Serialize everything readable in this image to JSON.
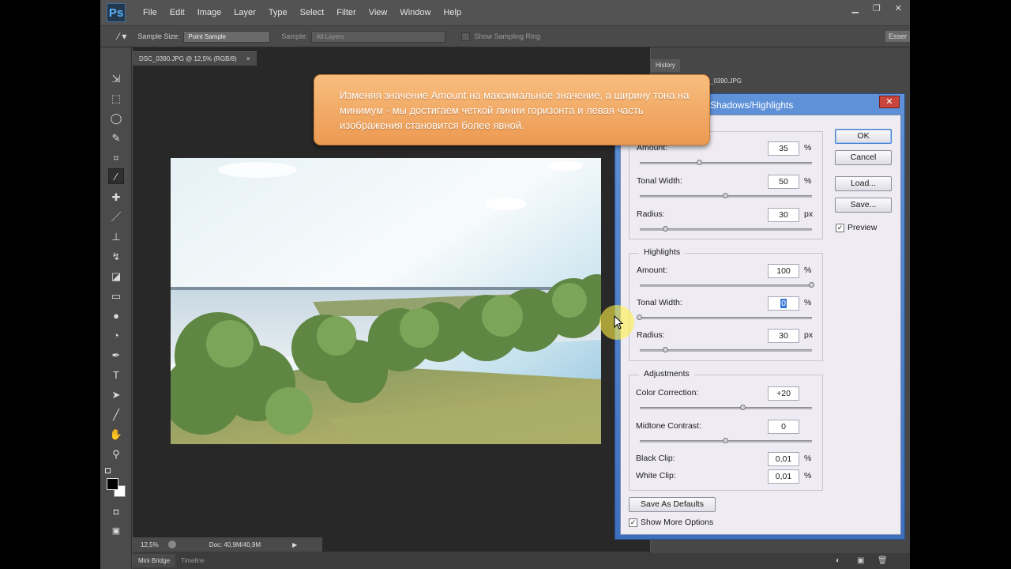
{
  "menubar": {
    "logo": "Ps",
    "items": [
      "File",
      "Edit",
      "Image",
      "Layer",
      "Type",
      "Select",
      "Filter",
      "View",
      "Window",
      "Help"
    ]
  },
  "optionsbar": {
    "sample_size_label": "Sample Size:",
    "sample_size_value": "Point Sample",
    "sample_label": "Sample:",
    "sample_value": "All Layers",
    "sampling_ring_label": "Show Sampling Ring",
    "essentials": "Esser"
  },
  "document": {
    "tab_title": "DSC_0390.JPG @ 12,5% (RGB/8)",
    "zoom": "12,5%",
    "doc_size": "Doc: 40,9M/40,9M"
  },
  "bottom_tabs": [
    "Mini Bridge",
    "Timeline"
  ],
  "history": {
    "tab": "History",
    "snapshot_name": "_0390.JPG"
  },
  "tooltip": {
    "text": "Изменяя значение Amount на максимальное значение, а ширину тона на минимум - мы достигаем четкой линии горизонта и левая часть изображения становится более явной."
  },
  "dialog": {
    "title": "Shadows/Highlights",
    "shadows": {
      "amount_label": "Amount:",
      "amount_value": "35",
      "amount_unit": "%",
      "amount_slider": 0.35,
      "tonal_label": "Tonal Width:",
      "tonal_value": "50",
      "tonal_unit": "%",
      "tonal_slider": 0.5,
      "radius_label": "Radius:",
      "radius_value": "30",
      "radius_unit": "px",
      "radius_slider": 0.15
    },
    "highlights": {
      "legend": "Highlights",
      "amount_label": "Amount:",
      "amount_value": "100",
      "amount_unit": "%",
      "amount_slider": 1.0,
      "tonal_label": "Tonal Width:",
      "tonal_value": "0",
      "tonal_unit": "%",
      "tonal_slider": 0.0,
      "radius_label": "Radius:",
      "radius_value": "30",
      "radius_unit": "px",
      "radius_slider": 0.15
    },
    "adjustments": {
      "legend": "Adjustments",
      "color_label": "Color Correction:",
      "color_value": "+20",
      "color_slider": 0.6,
      "midtone_label": "Midtone Contrast:",
      "midtone_value": "0",
      "midtone_slider": 0.5,
      "black_clip_label": "Black Clip:",
      "black_clip_value": "0,01",
      "black_clip_unit": "%",
      "white_clip_label": "White Clip:",
      "white_clip_value": "0,01",
      "white_clip_unit": "%"
    },
    "buttons": {
      "ok": "OK",
      "cancel": "Cancel",
      "load": "Load...",
      "save": "Save...",
      "save_defaults": "Save As Defaults"
    },
    "preview_label": "Preview",
    "preview_checked": true,
    "show_more_label": "Show More Options",
    "show_more_checked": true
  },
  "colors": {
    "accent": "#3e6fbe",
    "tooltip": "#ec9a52"
  }
}
